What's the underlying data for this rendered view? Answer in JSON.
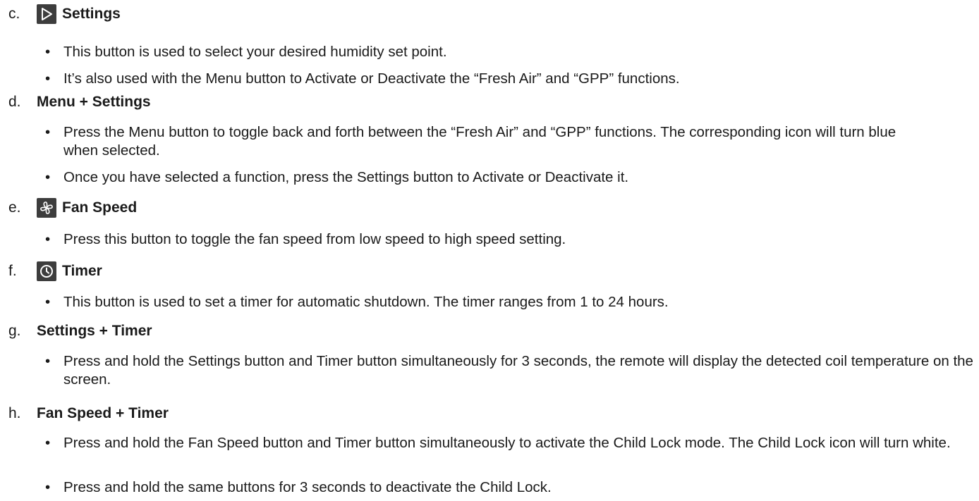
{
  "sections": [
    {
      "letter": "c.",
      "title": "Settings",
      "icon": "play-triangle-icon",
      "bullets": [
        "This button is used to select your desired humidity set point.",
        "It’s also used with the Menu button to Activate or Deactivate the “Fresh Air” and “GPP” functions."
      ]
    },
    {
      "letter": "d.",
      "title": "Menu + Settings",
      "bullets": [
        "Press the Menu button to toggle back and forth between the “Fresh Air” and “GPP” functions. The corresponding icon will turn blue when selected.",
        "Once you have selected a function, press the Settings button to Activate or Deactivate it."
      ]
    },
    {
      "letter": "e.",
      "title": "Fan Speed",
      "icon": "fan-icon",
      "bullets": [
        "Press this button to toggle the fan speed from low speed to high speed setting."
      ]
    },
    {
      "letter": "f.",
      "title": "Timer",
      "icon": "clock-icon",
      "bullets": [
        "This button is used to set a timer for automatic shutdown. The timer ranges from 1 to 24 hours."
      ]
    },
    {
      "letter": "g.",
      "title": "Settings + Timer",
      "bullets": [
        "Press and hold the Settings button and Timer button simultaneously for 3 seconds, the remote will display the detected coil temperature on the screen."
      ]
    },
    {
      "letter": "h.",
      "title": "Fan Speed + Timer",
      "bullets": [
        "Press and hold the Fan Speed button and Timer button simultaneously to activate the Child Lock mode. The Child Lock icon will turn white.",
        "Press and hold the same buttons for 3 seconds to deactivate the Child Lock."
      ]
    }
  ]
}
